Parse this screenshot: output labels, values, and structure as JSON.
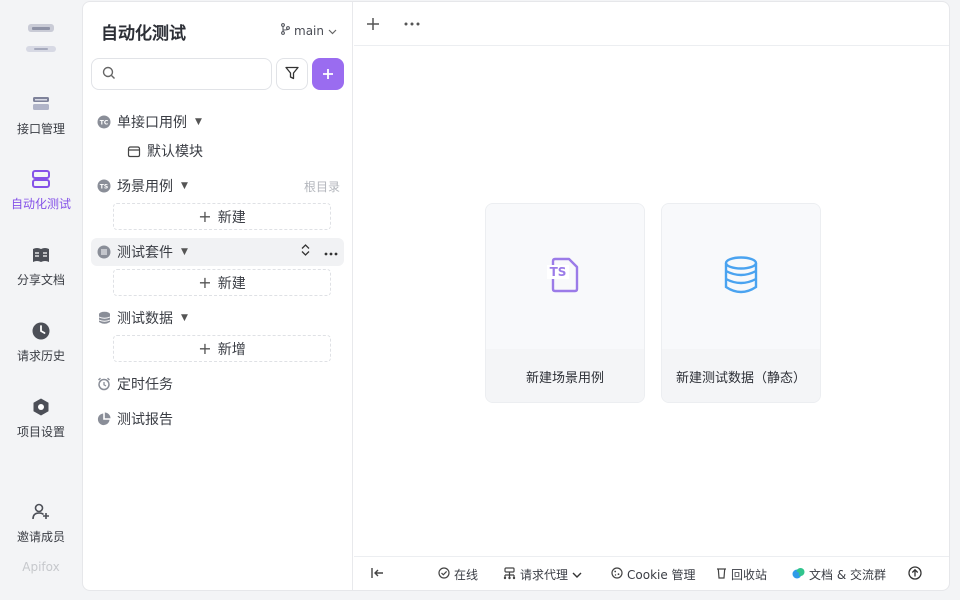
{
  "rail": {
    "items": [
      {
        "label": "接口管理",
        "icon": "api-management-icon"
      },
      {
        "label": "自动化测试",
        "icon": "automation-test-icon"
      },
      {
        "label": "分享文档",
        "icon": "shared-docs-icon"
      },
      {
        "label": "请求历史",
        "icon": "history-clock-icon"
      },
      {
        "label": "项目设置",
        "icon": "settings-hexagon-icon"
      },
      {
        "label": "邀请成员",
        "icon": "invite-member-icon"
      }
    ],
    "brand": "Apifox",
    "accent": "#8552e8"
  },
  "tree": {
    "title": "自动化测试",
    "branch": "main",
    "search": {
      "placeholder": "",
      "value": ""
    },
    "single_case": {
      "label": "单接口用例",
      "child": "默认模块"
    },
    "scenario": {
      "label": "场景用例",
      "right": "根目录",
      "new": "新建"
    },
    "suite": {
      "label": "测试套件",
      "new": "新建"
    },
    "data": {
      "label": "测试数据",
      "new": "新增"
    },
    "scheduled": {
      "label": "定时任务"
    },
    "report": {
      "label": "测试报告"
    }
  },
  "cards": {
    "scenario": {
      "label": "新建场景用例",
      "icon": "ts-file-icon",
      "color": "#9b7be8"
    },
    "data": {
      "label": "新建测试数据（静态）",
      "icon": "database-icon",
      "color": "#4aa3f0"
    }
  },
  "status": {
    "online": "在线",
    "proxy": "请求代理",
    "cookie": "Cookie 管理",
    "trash": "回收站",
    "docs": "文档 & 交流群"
  }
}
